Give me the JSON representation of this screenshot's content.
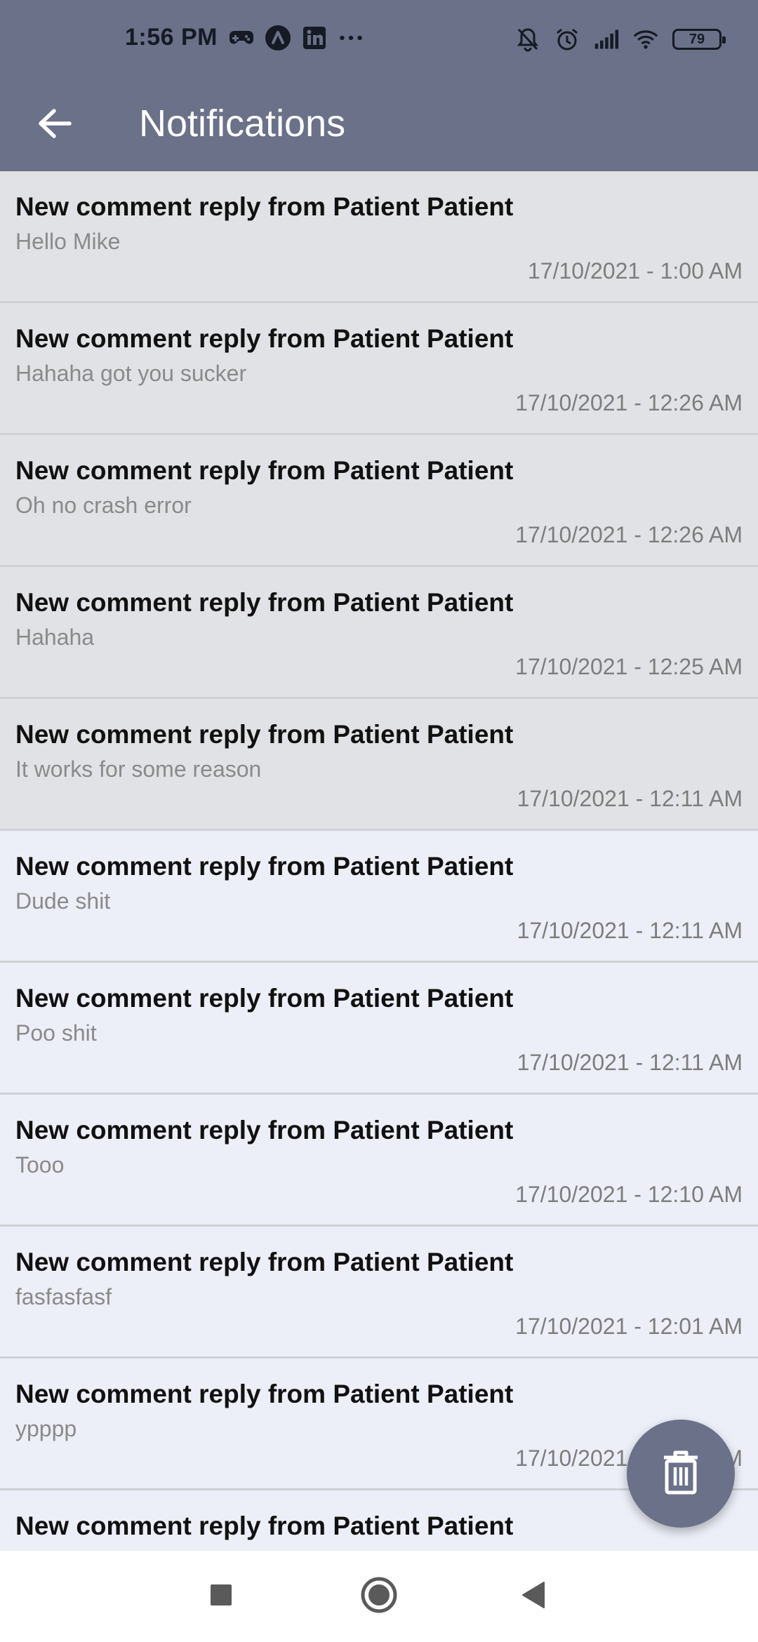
{
  "status_bar": {
    "time": "1:56 PM",
    "battery": "79",
    "left_icons": [
      "gamepad-icon",
      "arc-icon",
      "linkedin-icon",
      "more-icon"
    ],
    "right_icons": [
      "bell-off-icon",
      "alarm-icon",
      "signal-icon",
      "wifi-icon"
    ]
  },
  "app_bar": {
    "title": "Notifications"
  },
  "notifications": [
    {
      "title": "New comment reply from Patient Patient",
      "body": "Hello Mike",
      "time": "17/10/2021 - 1:00 AM",
      "read": true
    },
    {
      "title": "New comment reply from Patient Patient",
      "body": "Hahaha got you sucker",
      "time": "17/10/2021 - 12:26 AM",
      "read": true
    },
    {
      "title": "New comment reply from Patient Patient",
      "body": "Oh no crash error",
      "time": "17/10/2021 - 12:26 AM",
      "read": true
    },
    {
      "title": "New comment reply from Patient Patient",
      "body": "Hahaha",
      "time": "17/10/2021 - 12:25 AM",
      "read": true
    },
    {
      "title": "New comment reply from Patient Patient",
      "body": "It works for some reason",
      "time": "17/10/2021 - 12:11 AM",
      "read": true
    },
    {
      "title": "New comment reply from Patient Patient",
      "body": "Dude shit",
      "time": "17/10/2021 - 12:11 AM",
      "read": false
    },
    {
      "title": "New comment reply from Patient Patient",
      "body": "Poo shit",
      "time": "17/10/2021 - 12:11 AM",
      "read": false
    },
    {
      "title": "New comment reply from Patient Patient",
      "body": "Tooo",
      "time": "17/10/2021 - 12:10 AM",
      "read": false
    },
    {
      "title": "New comment reply from Patient Patient",
      "body": "fasfasfasf",
      "time": "17/10/2021 - 12:01 AM",
      "read": false
    },
    {
      "title": "New comment reply from Patient Patient",
      "body": "ypppp",
      "time": "17/10/2021 - 12:00 AM",
      "read": false
    },
    {
      "title": "New comment reply from Patient Patient",
      "body": "",
      "time": "",
      "read": false
    }
  ],
  "fab": {
    "icon": "trash-icon"
  },
  "nav_bar": {
    "icons": [
      "recents-square-icon",
      "home-circle-icon",
      "back-triangle-icon"
    ]
  },
  "colors": {
    "app_bar": "#6a7188",
    "read_row": "#e1e2e6",
    "unread_row": "#eceef8",
    "divider": "#cfd1d6"
  }
}
